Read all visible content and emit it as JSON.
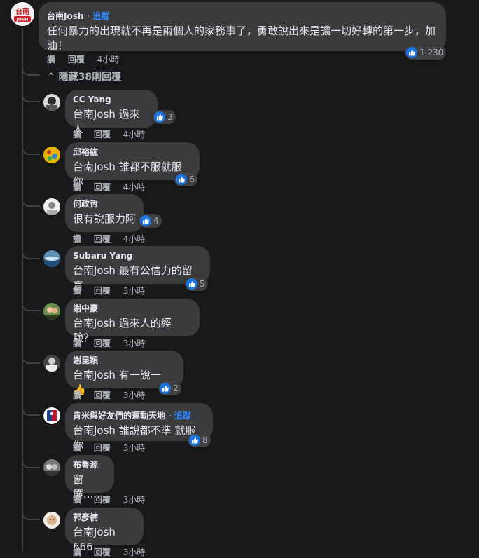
{
  "top_comment": {
    "author": "台南Josh",
    "follow": "追蹤",
    "text": "任何暴力的出現就不再是兩個人的家務事了，勇敢說出來是讓一切好轉的第一步，加油！",
    "like_label": "讚",
    "reply_label": "回覆",
    "time": "4小時",
    "reaction_count": "1,230"
  },
  "hide_replies": {
    "chevron": "⌃",
    "label": "隱藏38則回覆"
  },
  "replies": [
    {
      "author": "CC Yang",
      "text": "台南Josh 過來人",
      "like_label": "讚",
      "reply_label": "回覆",
      "time": "4小時",
      "reaction_count": "3"
    },
    {
      "author": "邱裕紘",
      "text": "台南Josh 誰都不服就服你",
      "like_label": "讚",
      "reply_label": "回覆",
      "time": "4小時",
      "reaction_count": "6"
    },
    {
      "author": "何政哲",
      "text": "很有說服力阿",
      "like_label": "讚",
      "reply_label": "回覆",
      "time": "4小時",
      "reaction_count": "4"
    },
    {
      "author": "Subaru Yang",
      "text": "台南Josh 最有公信力的留言",
      "like_label": "讚",
      "reply_label": "回覆",
      "time": "3小時",
      "reaction_count": "5"
    },
    {
      "author": "謝中豪",
      "text": "台南Josh 過來人的經驗？",
      "like_label": "讚",
      "reply_label": "回覆",
      "time": "3小時"
    },
    {
      "author": "謝昆穎",
      "text": "台南Josh 有一說一 👍",
      "like_label": "讚",
      "reply_label": "回覆",
      "time": "3小時",
      "reaction_count": "2"
    },
    {
      "author": "肯米與好友們的運動天地",
      "follow": "追蹤",
      "text": "台南Josh 誰說都不準 就服你",
      "like_label": "讚",
      "reply_label": "回覆",
      "time": "3小時",
      "reaction_count": "8"
    },
    {
      "author": "布魯源",
      "text": "窗簾.....",
      "like_label": "讚",
      "reply_label": "回覆",
      "time": "3小時"
    },
    {
      "author": "郭彥楠",
      "text": "台南Josh 666",
      "like_label": "讚",
      "reply_label": "回覆",
      "time": "3小時"
    }
  ],
  "colors": {
    "background": "#18191a",
    "bubble": "#3a3b3c",
    "accent": "#2d88ff",
    "like": "#1b74e4"
  },
  "icons": {
    "like": "thumbs-up-icon",
    "avatar": "avatar-icon"
  },
  "logo_text": "台南 JOSH"
}
